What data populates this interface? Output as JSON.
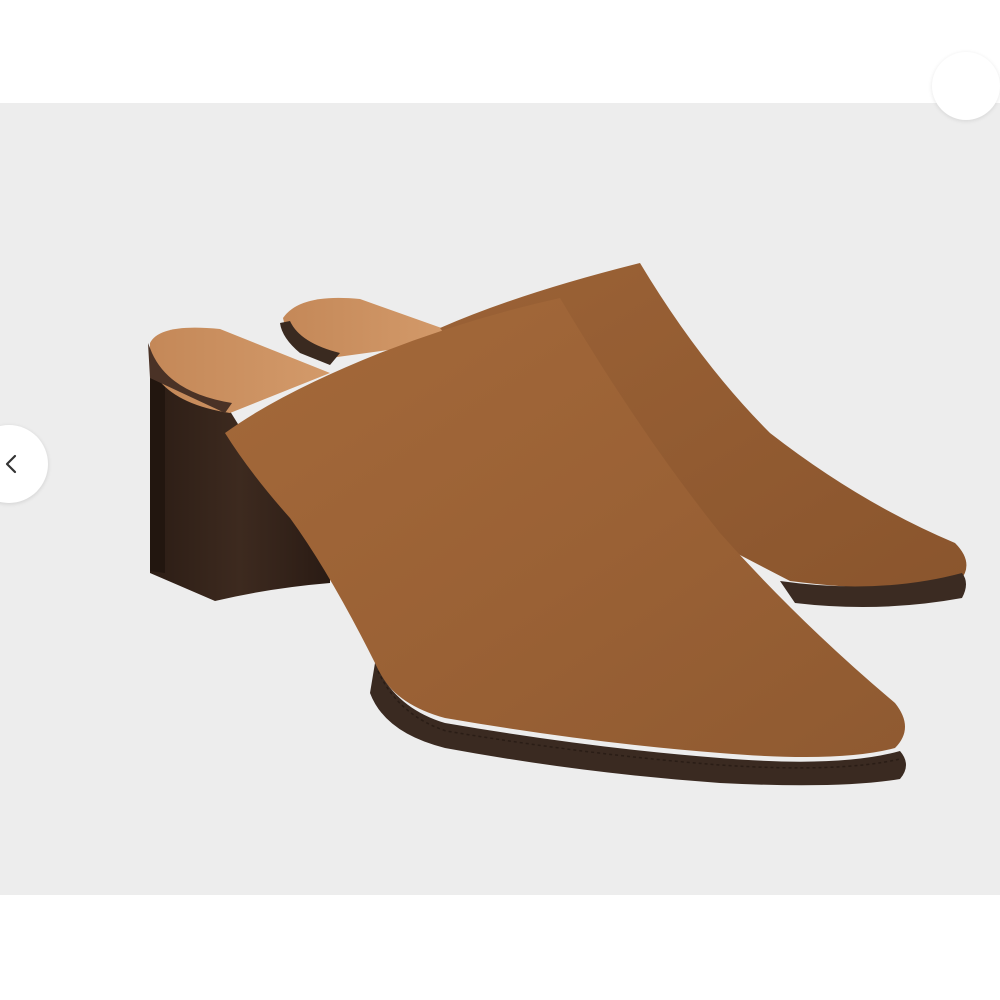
{
  "viewer": {
    "background": "#ffffff",
    "photo_background": "#ededed",
    "product_color": "#a0673a",
    "heel_color": "#3b2a20",
    "prev_icon": "chevron-left-icon"
  }
}
